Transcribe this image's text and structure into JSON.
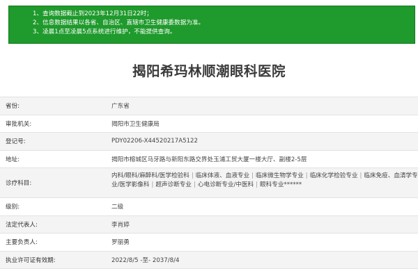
{
  "notice": {
    "lines": [
      "1、查询数据截止到2023年12月31日22时；",
      "2、信息数据结果以各省、自治区、直辖市卫生健康委数据为准。",
      "3、凌晨1点至凌晨5点系统进行维护，不能提供查询。"
    ]
  },
  "hospital": {
    "name": "揭阳希玛林顺潮眼科医院"
  },
  "info": {
    "province_label": "省份:",
    "province_value": "广东省",
    "approver_label": "审批机关:",
    "approver_value": "揭阳市卫生健康局",
    "reg_label": "登记号:",
    "reg_value": "PDY02206-X44520217A5122",
    "address_label": "地址:",
    "address_value": "揭阳市榕城区马牙路与新阳东路交界处玉浦工贸大厦一楼大厅、副楼2-5层",
    "subjects_label": "诊疗科目:",
    "subjects": [
      "内科",
      "/眼科",
      "/麻醉科",
      "/医学检验科",
      "临床体液、血液专业",
      "临床微生物学专业",
      "临床化学检验专业",
      "临床免疫、血清学专业",
      "/医学影像科",
      "超声诊断专业",
      "心电诊断专业",
      "/中医科",
      "眼科专业******"
    ],
    "level_label": "级别:",
    "level_value": "二级",
    "legal_rep_label": "法定代表人:",
    "legal_rep_value": "李肖婷",
    "principal_label": "主要负责人:",
    "principal_value": "罗丽勇",
    "license_label": "执业许可证有效期:",
    "license_value": "2022/8/5 -至- 2037/8/4"
  }
}
